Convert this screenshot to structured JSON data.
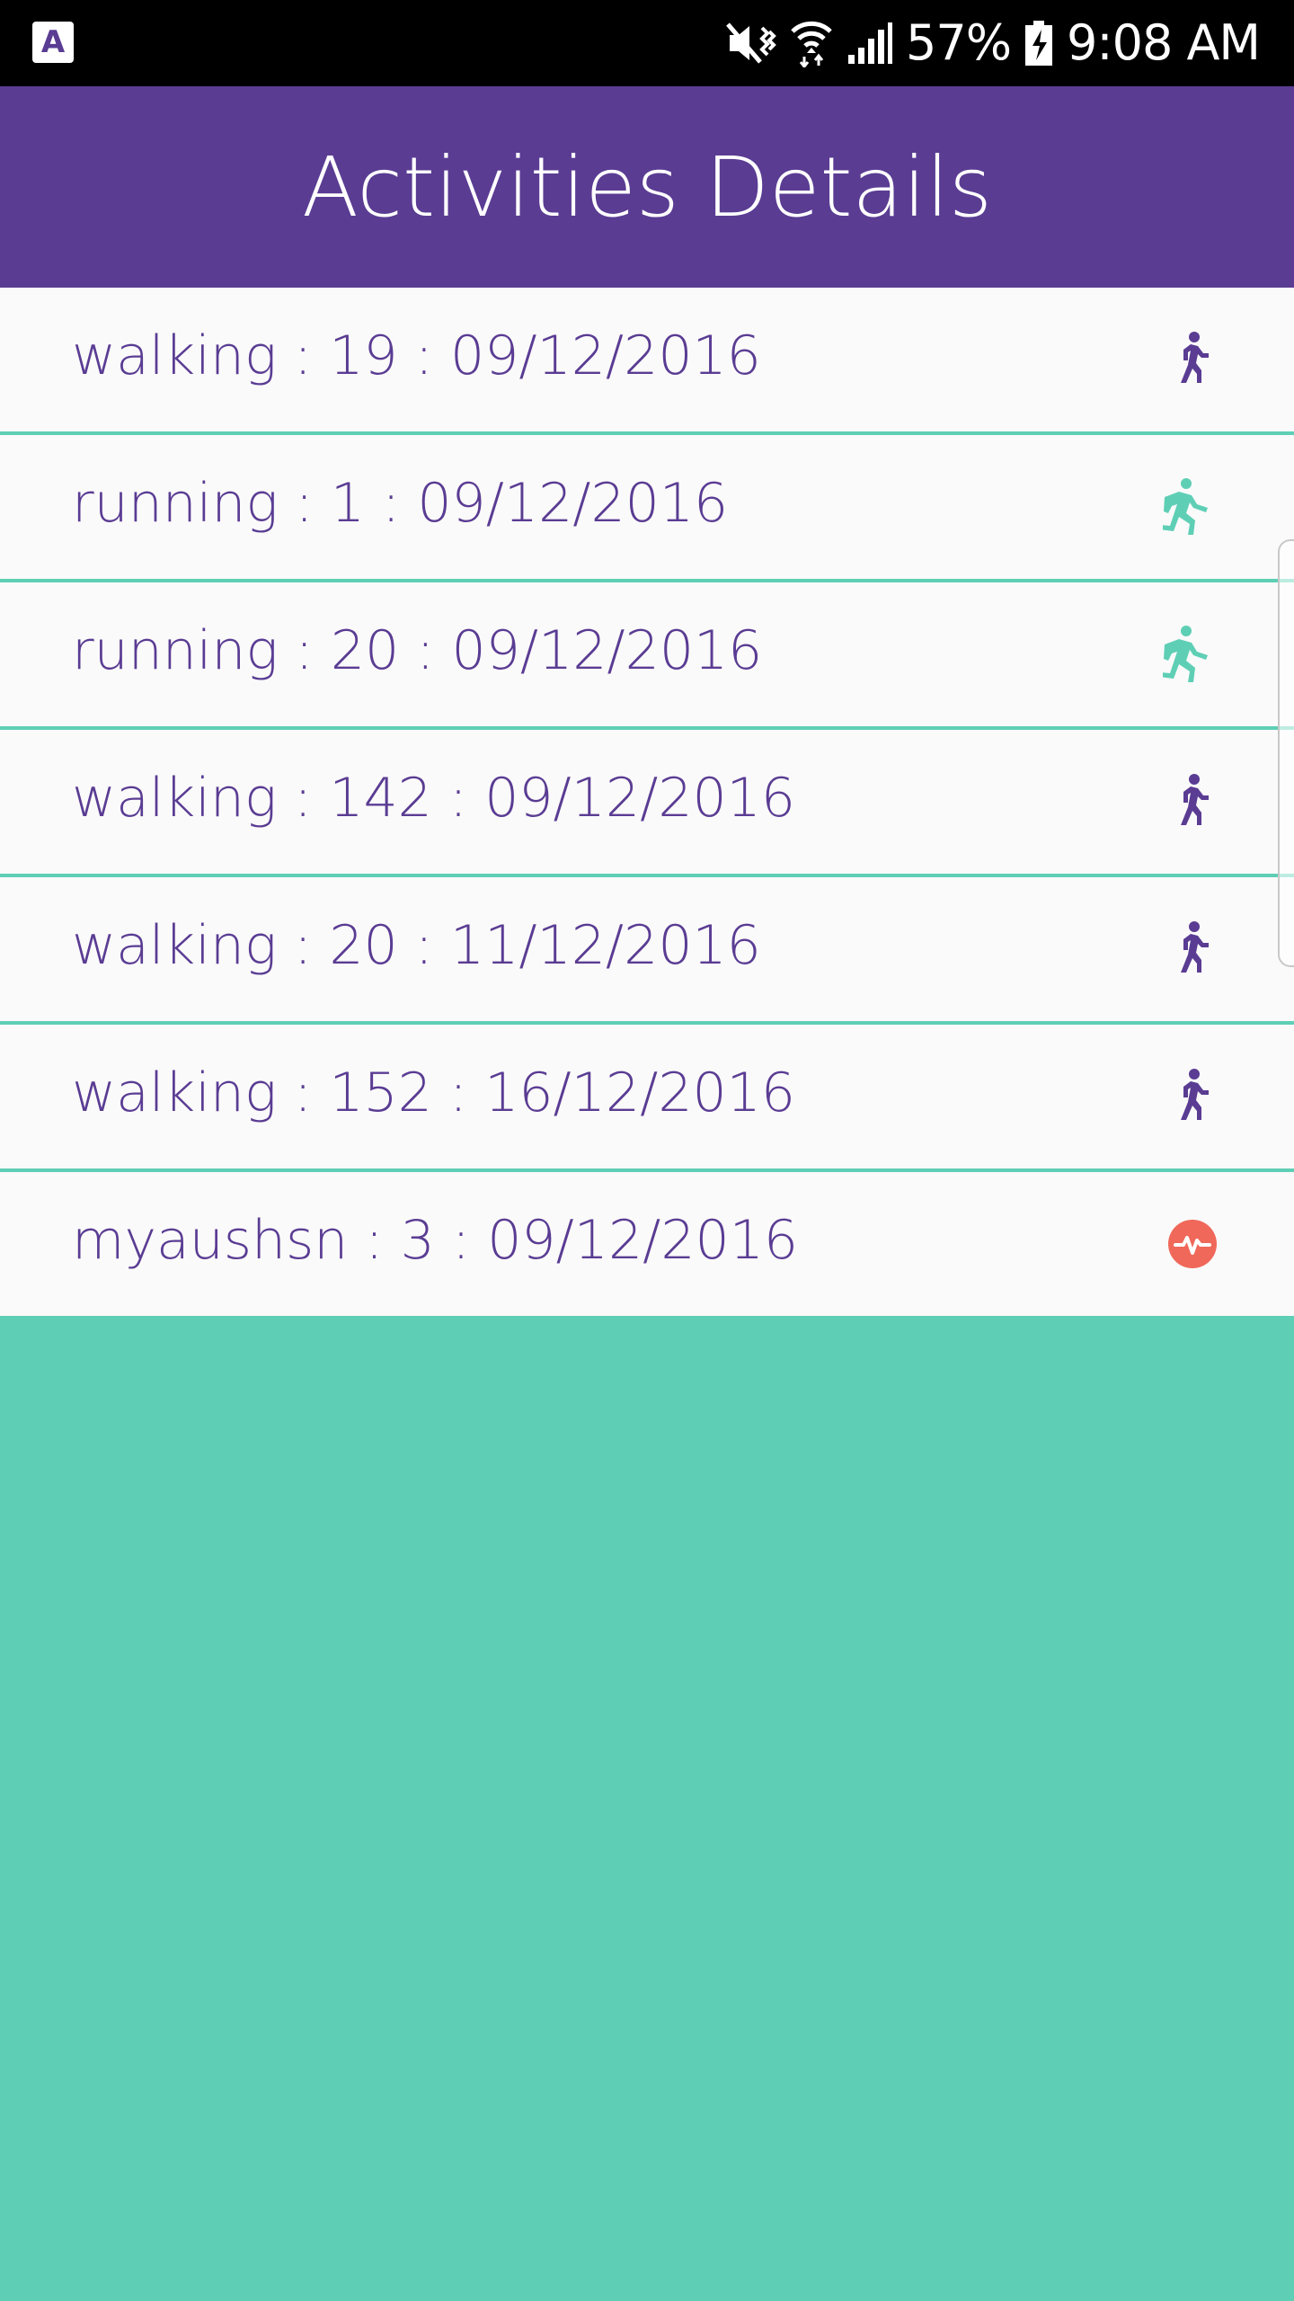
{
  "status_bar": {
    "app_icon_letter": "A",
    "battery": "57%",
    "time": "9:08 AM"
  },
  "header": {
    "title": "Activities Details"
  },
  "activities": [
    {
      "label": "walking : 19 : 09/12/2016",
      "icon": "walking-icon"
    },
    {
      "label": "running : 1 : 09/12/2016",
      "icon": "running-icon"
    },
    {
      "label": "running : 20 : 09/12/2016",
      "icon": "running-icon"
    },
    {
      "label": "walking : 142 : 09/12/2016",
      "icon": "walking-icon"
    },
    {
      "label": "walking : 20 : 11/12/2016",
      "icon": "walking-icon"
    },
    {
      "label": "walking : 152 : 16/12/2016",
      "icon": "walking-icon"
    },
    {
      "label": "myaushsn : 3 : 09/12/2016",
      "icon": "heartbeat-icon"
    }
  ],
  "colors": {
    "primary": "#5a3c93",
    "accent": "#5ecfb5",
    "heartbeat": "#f0685a",
    "row_background": "#fafafa"
  }
}
